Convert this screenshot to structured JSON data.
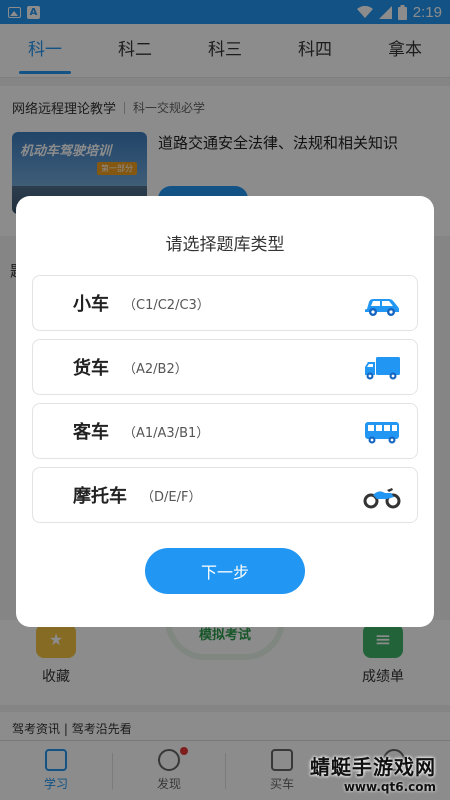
{
  "status_bar": {
    "time": "2:19"
  },
  "tabs": [
    {
      "label": "科一",
      "active": true
    },
    {
      "label": "科二",
      "active": false
    },
    {
      "label": "科三",
      "active": false
    },
    {
      "label": "科四",
      "active": false
    },
    {
      "label": "拿本",
      "active": false
    }
  ],
  "background": {
    "section_title": "网络远程理论教学",
    "section_sub": "科一交规必学",
    "thumb_title": "机动车驾驶培训",
    "thumb_tag": "第一部分",
    "course_title": "道路交通安全法律、法规和相关知识",
    "side_letter": "题",
    "favorites": "收藏",
    "mock_exam": "模拟考试",
    "scores": "成绩单",
    "news_title": "驾考资讯",
    "news_sub": "驾考沿先看"
  },
  "bottom_nav": [
    {
      "label": "学习",
      "active": true
    },
    {
      "label": "发现",
      "active": false
    },
    {
      "label": "买车",
      "active": false
    },
    {
      "label": "",
      "active": false
    }
  ],
  "watermark": {
    "line1": "蜻蜓手游戏网",
    "line2": "www.qt6.com"
  },
  "dialog": {
    "title": "请选择题库类型",
    "options": [
      {
        "name": "小车",
        "code": "（C1/C2/C3）",
        "icon": "car-icon"
      },
      {
        "name": "货车",
        "code": "（A2/B2）",
        "icon": "truck-icon"
      },
      {
        "name": "客车",
        "code": "（A1/A3/B1）",
        "icon": "bus-icon"
      },
      {
        "name": "摩托车",
        "code": "（D/E/F）",
        "icon": "motorcycle-icon"
      }
    ],
    "next_label": "下一步"
  },
  "colors": {
    "accent": "#2196f3",
    "overlay": "rgba(0,0,0,0.45)"
  }
}
